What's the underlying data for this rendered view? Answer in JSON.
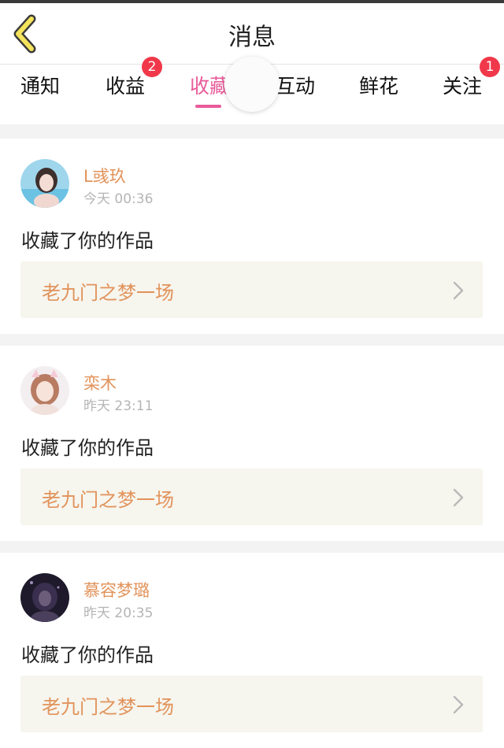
{
  "header": {
    "title": "消息"
  },
  "tabs": [
    {
      "label": "通知",
      "badge": ""
    },
    {
      "label": "收益",
      "badge": "2"
    },
    {
      "label": "收藏",
      "badge": "",
      "active": true
    },
    {
      "label": "互动",
      "badge": ""
    },
    {
      "label": "鲜花",
      "badge": ""
    },
    {
      "label": "关注",
      "badge": "1"
    }
  ],
  "colors": {
    "accent_pink": "#e95b9a",
    "name_orange": "#e2935b",
    "badge_red": "#f0384a"
  },
  "messages": [
    {
      "name": "L彧玖",
      "time": "今天 00:36",
      "action": "收藏了你的作品",
      "work": "老九门之梦一场"
    },
    {
      "name": "栾木",
      "time": "昨天 23:11",
      "action": "收藏了你的作品",
      "work": "老九门之梦一场"
    },
    {
      "name": "慕容梦璐",
      "time": "昨天 20:35",
      "action": "收藏了你的作品",
      "work": "老九门之梦一场"
    }
  ]
}
